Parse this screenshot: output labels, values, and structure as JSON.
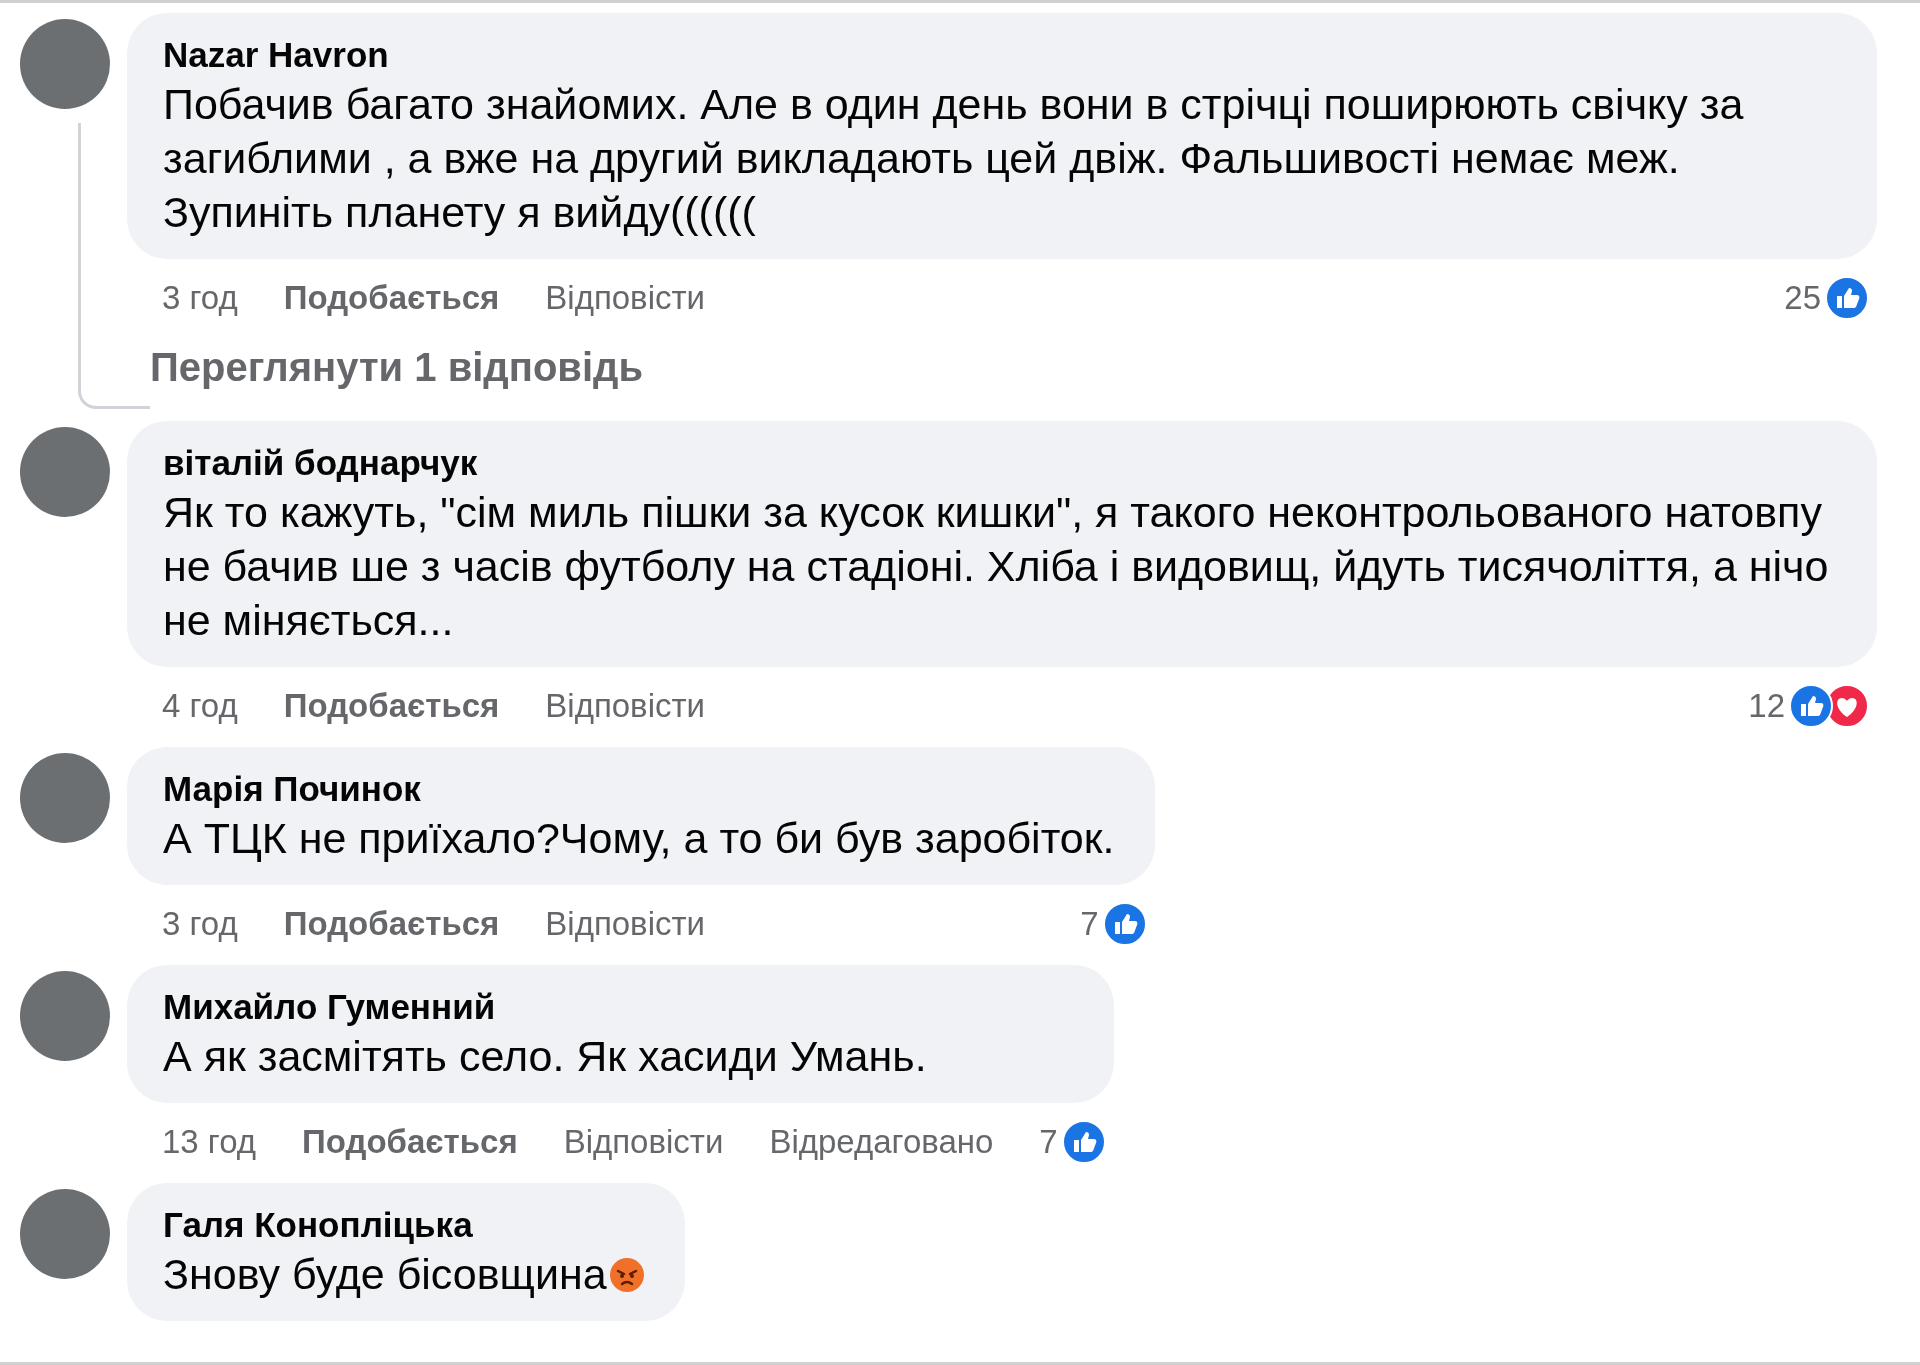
{
  "comments": [
    {
      "author": "Nazar Havron",
      "text": "Побачив багато знайомих. Але в один день вони в стрічці поширюють свічку за загиблими , а вже на другий викладають цей двіж. Фальшивості немає меж. Зупиніть планету я вийду((((((",
      "time": "3 год",
      "like_label": "Подобається",
      "reply_label": "Відповісти",
      "reaction_count": "25",
      "reactions": [
        {
          "kind": "like"
        }
      ],
      "replies_link": "Переглянути 1 відповідь"
    },
    {
      "author": "віталій боднарчук",
      "text": "Як то кажуть, \"сім миль пішки за кусок кишки\", я такого неконтрольованого натовпу не бачив ше з часів футболу на стадіоні. Хліба і видовищ, йдуть тисячоліття, а нічо не міняється...",
      "time": "4 год",
      "like_label": "Подобається",
      "reply_label": "Відповісти",
      "reaction_count": "12",
      "reactions": [
        {
          "kind": "like"
        },
        {
          "kind": "love"
        }
      ]
    },
    {
      "author": "Марія Починок",
      "text": "А ТЦК не приїхало?Чому, а то би був заробіток.",
      "time": "3 год",
      "like_label": "Подобається",
      "reply_label": "Відповісти",
      "reaction_count": "7",
      "reactions": [
        {
          "kind": "like"
        }
      ]
    },
    {
      "author": "Михайло Гуменний",
      "text": "А як засмітять село. Як хасиди Умань.",
      "time": "13 год",
      "like_label": "Подобається",
      "reply_label": "Відповісти",
      "edited_label": "Відредаговано",
      "reaction_count": "7",
      "reactions": [
        {
          "kind": "like"
        }
      ]
    },
    {
      "author": "Галя Конопліцька",
      "text": "Знову буде бісовщина",
      "has_emoji": true
    }
  ]
}
